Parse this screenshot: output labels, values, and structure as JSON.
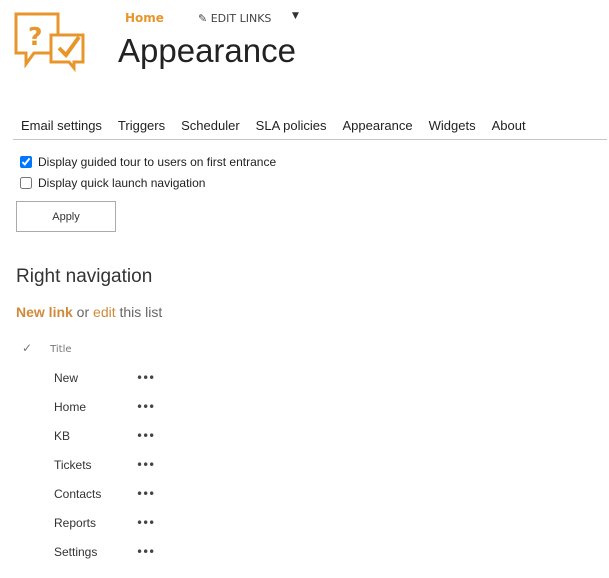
{
  "header": {
    "home": "Home",
    "edit_links": "EDIT LINKS",
    "title": "Appearance"
  },
  "tabs": [
    "Email settings",
    "Triggers",
    "Scheduler",
    "SLA policies",
    "Appearance",
    "Widgets",
    "About"
  ],
  "options": [
    {
      "label": "Display guided tour to users on first entrance",
      "checked": true
    },
    {
      "label": "Display quick launch navigation",
      "checked": false
    }
  ],
  "apply": "Apply",
  "section": {
    "title": "Right navigation",
    "new_link": "New link",
    "or": " or ",
    "edit": "edit",
    "rest": " this list",
    "col_title": "Title"
  },
  "items": [
    "New",
    "Home",
    "KB",
    "Tickets",
    "Contacts",
    "Reports",
    "Settings"
  ],
  "brand_color": "#e8962c"
}
